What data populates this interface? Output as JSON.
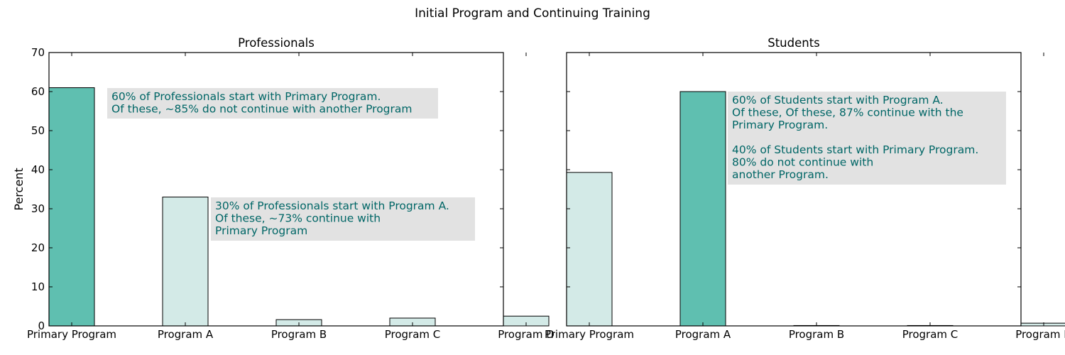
{
  "suptitle": "Initial Program and Continuing Training",
  "colors": {
    "highlight": "#5fbfb0",
    "normal": "#d3eae7",
    "annotation_text": "#006666",
    "annotation_bg": "#e2e2e2"
  },
  "chart_data": [
    {
      "type": "bar",
      "title": "Professionals",
      "ylabel": "Percent",
      "ylim": [
        0,
        70
      ],
      "yticks": [
        0,
        10,
        20,
        30,
        40,
        50,
        60,
        70
      ],
      "show_yticklabels": true,
      "categories": [
        "Primary Program",
        "Program A",
        "Program B",
        "Program C",
        "Program D"
      ],
      "values": [
        61,
        33,
        1.6,
        2,
        2.5
      ],
      "highlight": [
        true,
        false,
        false,
        false,
        false
      ],
      "annotations": [
        {
          "lines": [
            "60% of Professionals start with Primary Program.",
            "Of these, ~85% do not continue with another Program"
          ]
        },
        {
          "lines": [
            "30% of Professionals start with Program A.",
            "Of these, ~73% continue with",
            "Primary Program"
          ]
        }
      ]
    },
    {
      "type": "bar",
      "title": "Students",
      "ylabel": "",
      "ylim": [
        0,
        70
      ],
      "yticks": [
        0,
        10,
        20,
        30,
        40,
        50,
        60,
        70
      ],
      "show_yticklabels": false,
      "categories": [
        "Primary Program",
        "Program A",
        "Program B",
        "Program C",
        "Program D"
      ],
      "values": [
        39.3,
        60,
        0.1,
        0.1,
        0.7
      ],
      "highlight": [
        false,
        true,
        false,
        false,
        false
      ],
      "annotations": [
        {
          "lines": [
            "60% of Students start with Program A.",
            "Of these, Of these, 87% continue with the",
            "Primary Program.",
            "",
            "40% of Students start with Primary Program.",
            "80% do not continue with",
            "another Program."
          ]
        }
      ]
    }
  ]
}
